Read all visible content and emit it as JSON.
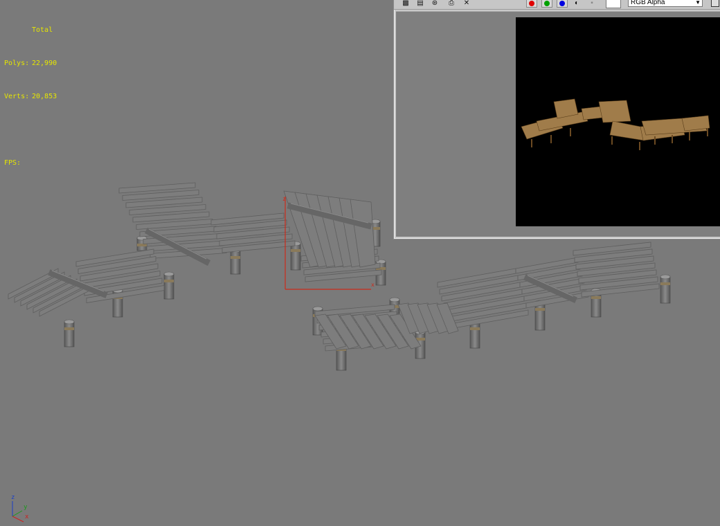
{
  "stats": {
    "header": "Total",
    "polys_label": "Polys:",
    "polys_value": "22,990",
    "verts_label": "Verts:",
    "verts_value": "20,853",
    "fps_label": "FPS:",
    "fps_value": ""
  },
  "axis_tripod": {
    "z": "z",
    "y": "y",
    "x": "x"
  },
  "render_window": {
    "channel_select": "RGB Alpha",
    "icons": [
      "save-icon",
      "copy-icon",
      "clone-icon",
      "print-icon",
      "clear-icon"
    ],
    "channel_buttons": [
      {
        "name": "red-channel-button",
        "color": "#e00000"
      },
      {
        "name": "green-channel-button",
        "color": "#00a000"
      },
      {
        "name": "blue-channel-button",
        "color": "#0000e0"
      }
    ]
  },
  "colors": {
    "viewport_bg": "#7a7a7a",
    "stats_text": "#e6e600",
    "plank": "#7d7d7d",
    "post": "#6e6e6e",
    "rope": "#8a7a5a",
    "wood": "#a07c4a",
    "gizmo": "#cc2a1a"
  }
}
